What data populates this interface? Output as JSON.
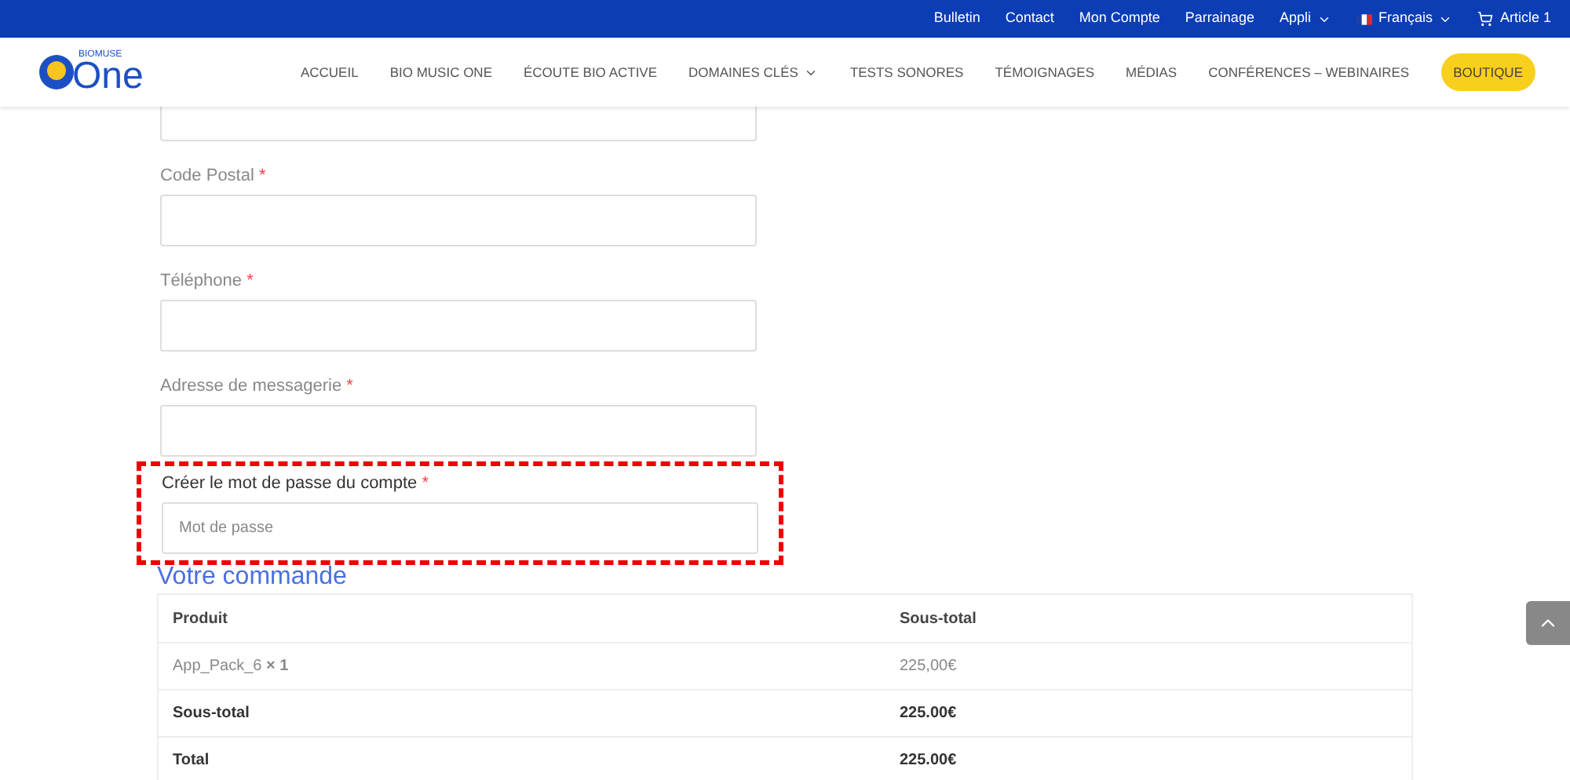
{
  "top_bar": {
    "links": [
      "Bulletin",
      "Contact",
      "Mon Compte",
      "Parrainage"
    ],
    "menus": [
      {
        "label": "Appli",
        "kind": "dropdown"
      },
      {
        "label": "Français",
        "kind": "language"
      }
    ],
    "cart": "Article 1"
  },
  "logo": {
    "small": "BIOMUSE",
    "large": "One"
  },
  "nav": {
    "items": [
      {
        "label": "ACCUEIL",
        "dropdown": false
      },
      {
        "label": "BIO MUSIC ONE",
        "dropdown": false
      },
      {
        "label": "ÉCOUTE BIO ACTIVE",
        "dropdown": false
      },
      {
        "label": "DOMAINES CLÉS",
        "dropdown": true
      },
      {
        "label": "TESTS SONORES",
        "dropdown": false
      },
      {
        "label": "TÉMOIGNAGES",
        "dropdown": false
      },
      {
        "label": "MÉDIAS",
        "dropdown": false
      },
      {
        "label": "CONFÉRENCES – WEBINAIRES",
        "dropdown": false
      }
    ],
    "cta": "BOUTIQUE"
  },
  "form": {
    "fields": [
      {
        "label": "Code Postal",
        "required": "*",
        "highlighted": false
      },
      {
        "label": "Téléphone",
        "required": "*",
        "highlighted": false
      },
      {
        "label": "Adresse de messagerie",
        "required": "*",
        "highlighted": false
      },
      {
        "label": "Créer le mot de passe du compte",
        "required": "*",
        "placeholder": "Mot de passe",
        "highlighted": true
      }
    ]
  },
  "order": {
    "title": "Votre commande",
    "columns": [
      "Produit",
      "Sous-total"
    ],
    "rows": [
      {
        "kind": "item",
        "product": "App_Pack_6 **× 1**",
        "amount": "225,00€"
      },
      {
        "kind": "summary",
        "product": "Sous-total",
        "amount": "225.00€"
      },
      {
        "kind": "summary",
        "product": "Total",
        "amount": "225.00€"
      }
    ]
  }
}
